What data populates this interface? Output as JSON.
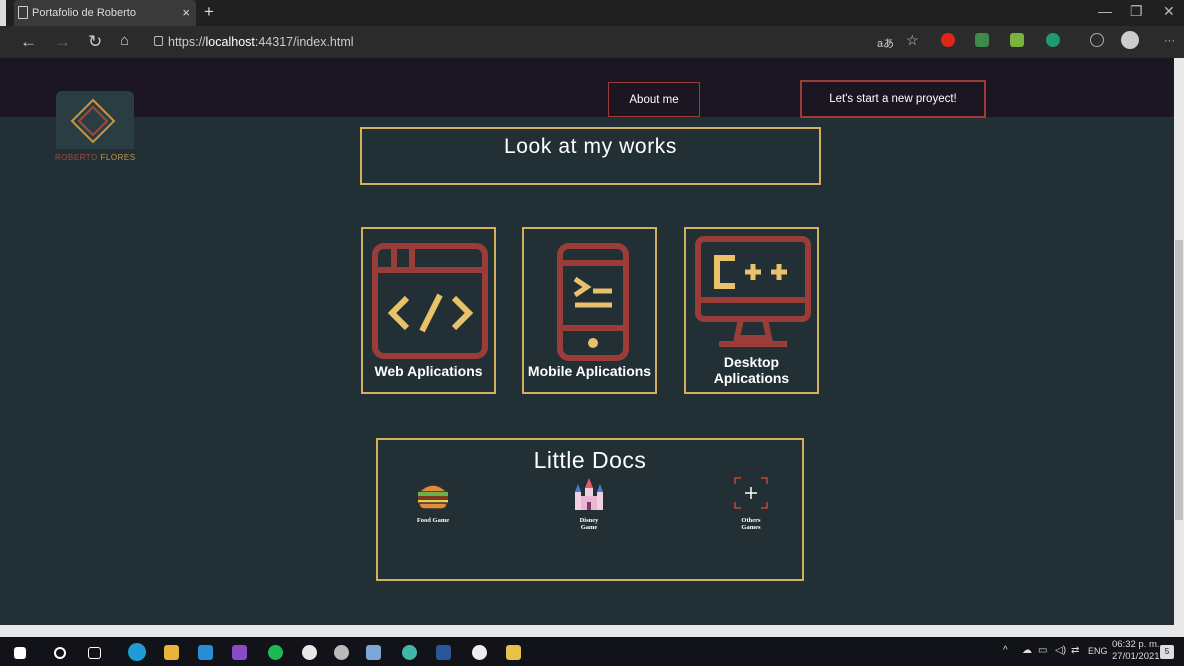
{
  "browser": {
    "tab_title": "Portafolio de Roberto",
    "tab_close": "×",
    "new_tab": "+",
    "url_prefix": "https://",
    "url_host": "localhost",
    "url_rest": ":44317/index.html",
    "read_aloud": "aあ",
    "more": "···"
  },
  "header": {
    "logo_text_first": "ROBERTO",
    "logo_text_last": "FLORES",
    "about_label": "About me",
    "new_project_label": "Let's start a new proyect!"
  },
  "works": {
    "title": "Look at my works",
    "cards": [
      {
        "label": "Web Aplications",
        "icon": "code-window-icon"
      },
      {
        "label": "Mobile Aplications",
        "icon": "mobile-terminal-icon"
      },
      {
        "label_line1": "Desktop",
        "label_line2": "Aplications",
        "icon": "cpp-monitor-icon"
      }
    ]
  },
  "docs": {
    "title": "Little Docs",
    "items": [
      {
        "label": "Food Game",
        "icon": "burger-icon"
      },
      {
        "label_line1": "Disney",
        "label_line2": "Game",
        "icon": "castle-icon"
      },
      {
        "label_line1": "Others",
        "label_line2": "Games",
        "icon": "add-frame-icon"
      }
    ]
  },
  "taskbar": {
    "language": "ENG",
    "time": "06:32 p. m.",
    "date": "27/01/2021",
    "notifications": "5"
  },
  "colors": {
    "accent_gold": "#d4b05e",
    "accent_red": "#9a3d39",
    "page_bg": "#223035",
    "header_bg": "#1c1522"
  }
}
